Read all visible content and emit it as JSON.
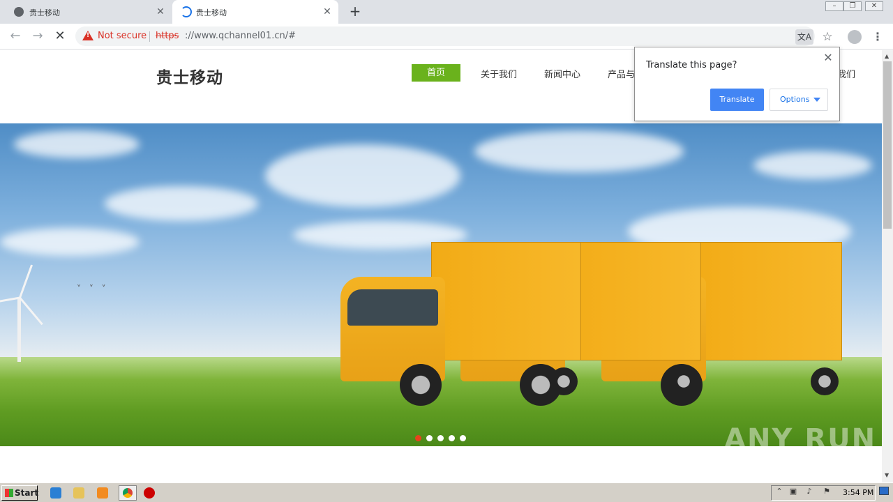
{
  "browser": {
    "tabs": [
      {
        "title": "贵士移动"
      },
      {
        "title": "贵士移动"
      }
    ],
    "new_tab_label": "+",
    "address_bar": {
      "security_label": "Not secure",
      "url_scheme": "https",
      "url_rest": "://www.qchannel01.cn/#"
    }
  },
  "site": {
    "logo": "贵士移动",
    "nav": [
      {
        "label": "首页"
      },
      {
        "label": "关于我们"
      },
      {
        "label": "新闻中心"
      },
      {
        "label": "产品与"
      },
      {
        "label": "我们"
      }
    ],
    "slider_dots": 5,
    "active_dot": 1
  },
  "translate_popup": {
    "title": "Translate this page?",
    "translate_label": "Translate",
    "options_label": "Options"
  },
  "watermark": "ANY RUN",
  "taskbar": {
    "start_label": "Start",
    "clock": "3:54 PM"
  }
}
